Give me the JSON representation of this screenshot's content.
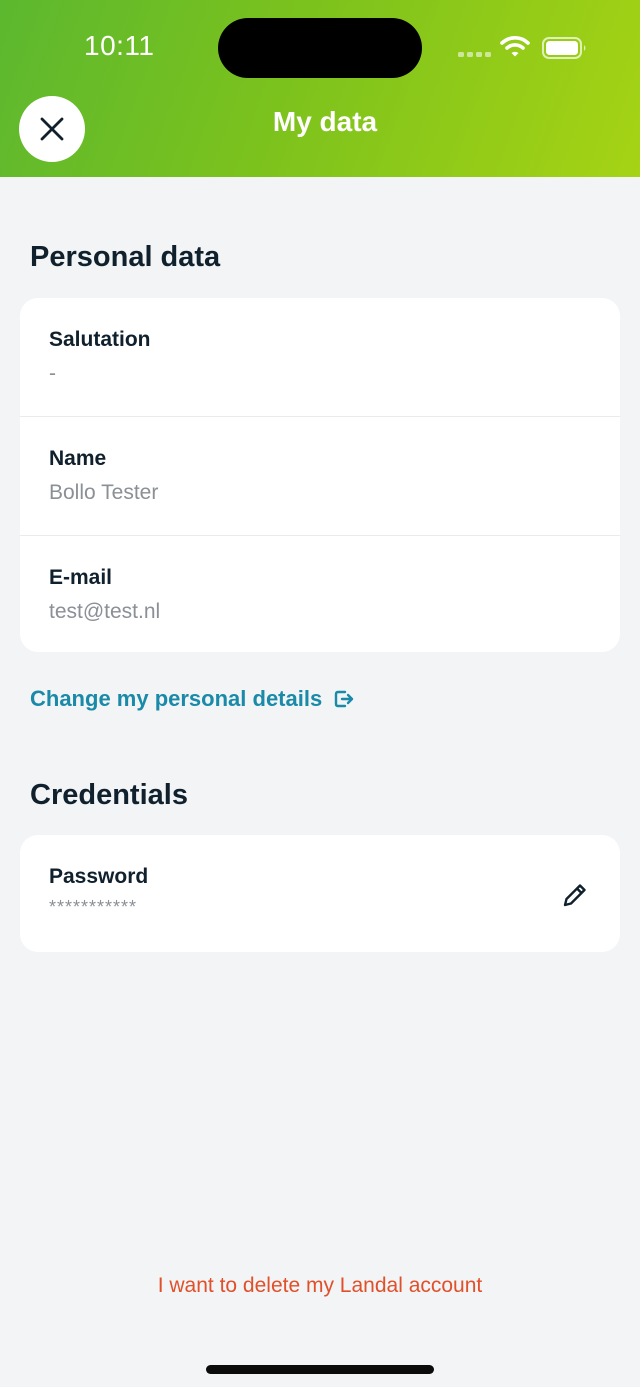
{
  "status_bar": {
    "time": "10:11"
  },
  "header": {
    "title": "My data",
    "close_icon": "close-icon"
  },
  "personal": {
    "title": "Personal data",
    "rows": [
      {
        "label": "Salutation",
        "value": "-"
      },
      {
        "label": "Name",
        "value": "Bollo Tester"
      },
      {
        "label": "E-mail",
        "value": "test@test.nl"
      }
    ],
    "change_link": "Change my personal details",
    "change_link_icon": "external-link-icon"
  },
  "credentials": {
    "title": "Credentials",
    "password_label": "Password",
    "password_value": "***********",
    "edit_icon": "pencil-icon"
  },
  "delete_link": "I want to delete my Landal account",
  "colors": {
    "header_gradient_start": "#5cb82f",
    "header_gradient_end": "#a6d314",
    "link": "#1a8aa8",
    "danger": "#e0502a",
    "background": "#f2f4f6"
  }
}
